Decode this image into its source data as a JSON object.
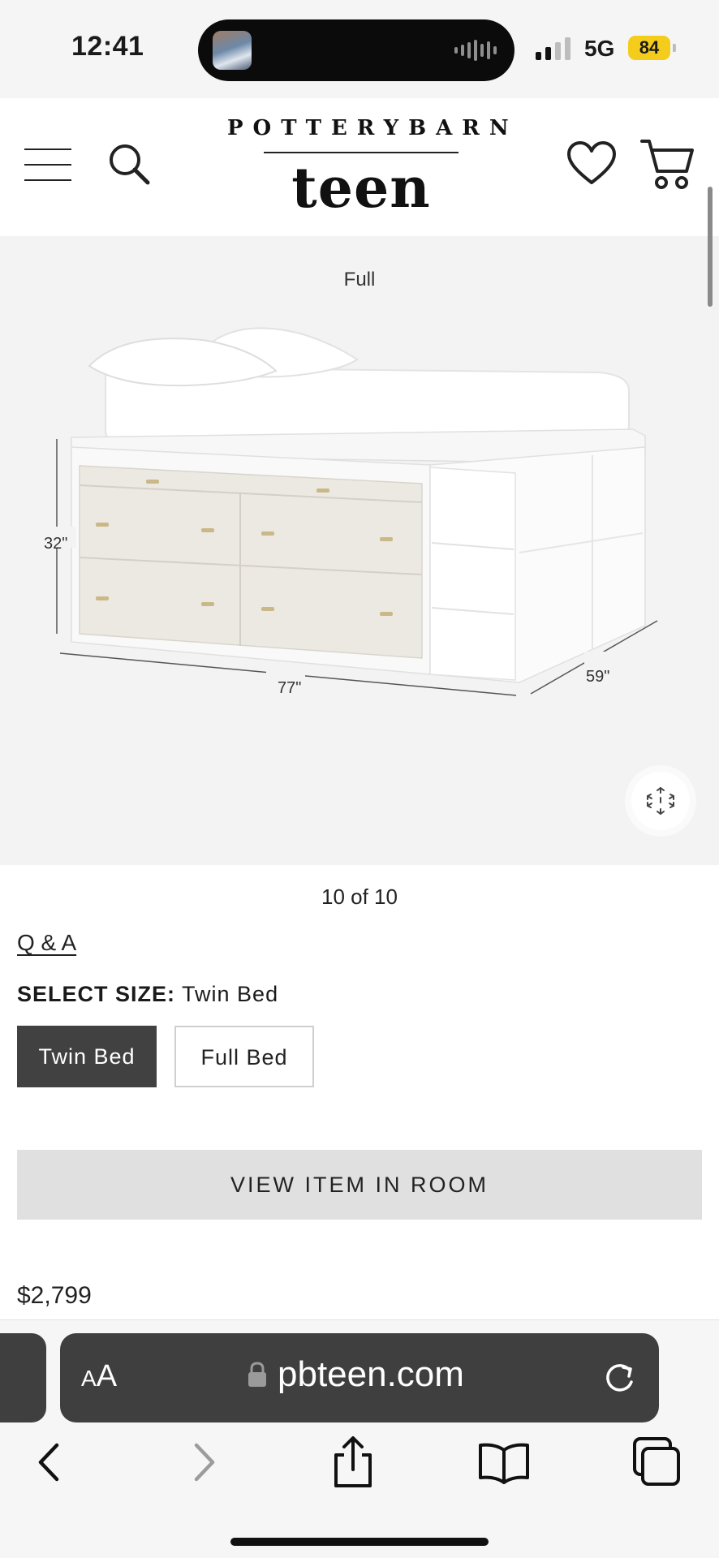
{
  "status_bar": {
    "time": "12:41",
    "network": "5G",
    "battery": "84",
    "battery_color": "#f4cd1c"
  },
  "header": {
    "logo_top": "POTTERYBARN",
    "logo_main": "teen",
    "icons": [
      "hamburger-menu-icon",
      "search-icon",
      "heart-icon",
      "cart-icon"
    ]
  },
  "gallery": {
    "caption": "Full",
    "dimensions": {
      "height": "32\"",
      "width": "77\"",
      "depth": "59\""
    },
    "counter": "10 of 10",
    "ar_icon": "3d-cube-icon"
  },
  "product": {
    "qa_link": "Q & A",
    "select_size_label": "SELECT SIZE:",
    "selected_size": "Twin Bed",
    "sizes": [
      {
        "label": "Twin Bed",
        "selected": true
      },
      {
        "label": "Full Bed",
        "selected": false
      }
    ],
    "view_in_room": "VIEW ITEM IN ROOM",
    "price": "$2,799",
    "accent_color": "#414141"
  },
  "browser": {
    "aa_label_small": "A",
    "aa_label_big": "A",
    "url": "pbteen.com",
    "icons": [
      "lock-icon",
      "reload-icon",
      "back-icon",
      "forward-icon",
      "share-icon",
      "bookmarks-icon",
      "tabs-icon"
    ]
  }
}
